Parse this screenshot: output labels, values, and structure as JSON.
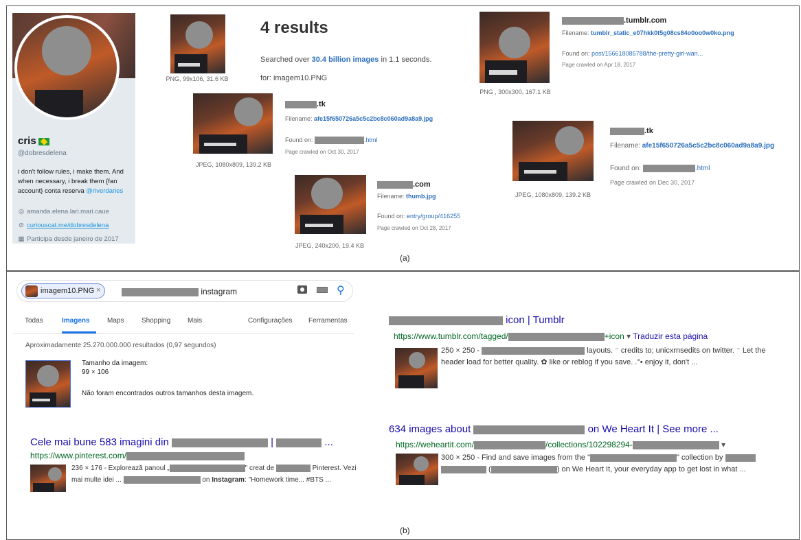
{
  "panel_a": {
    "caption": "(a)",
    "profile": {
      "name": "cris",
      "handle": "@dobresdelena",
      "bio": "i don't follow rules, i make them. And when necessary, i break them {fan account} conta reserva ",
      "bio_mention": "@riverdaries",
      "location": "amanda.elena.lari.mari.caue",
      "link": "curiouscat.me/dobresdelena",
      "joined": "Participa desde janeiro de 2017"
    },
    "query_image": {
      "meta": "PNG, 99x106, 31.6 KB"
    },
    "summary": {
      "results_title": "4 results",
      "searched_prefix": "Searched over ",
      "searched_count": "30.4 billion images",
      "searched_suffix": " in 1.1 seconds.",
      "for_label": "for: imagem10.PNG"
    },
    "matches": [
      {
        "host_suffix": ".tk",
        "filename_label": "Filename: ",
        "filename": "afe15f650726a5c5c2bc8c060ad9a8a9.jpg",
        "found_label": "Found on: ",
        "found_suffix": ".html",
        "crawled": "Page crawled on Oct 30, 2017",
        "meta": "JPEG, 1080x809, 139.2 KB"
      },
      {
        "host_suffix": ".com",
        "filename_label": "Filename: ",
        "filename": "thumb.jpg",
        "found_label": "Found on: ",
        "found_link": "entry/group/416255",
        "crawled": "Page crawled on Oct 28, 2017",
        "meta": "JPEG, 240x200, 19.4 KB"
      },
      {
        "host_suffix": ".tumblr.com",
        "filename_label": "Filename: ",
        "filename": "tumblr_static_e07hkk0t5g08cs84o0oo0w0ko.png",
        "found_label": "Found on: ",
        "found_link": "post/156618085788/the-pretty-girl-wan...",
        "crawled": "Page crawled on Apr 18, 2017",
        "meta": "PNG , 300x300, 167.1 KB"
      },
      {
        "host_suffix": ".tk",
        "filename_label": "Filename: ",
        "filename": "afe15f650726a5c5c2bc8c060ad9a8a9.jpg",
        "found_label": "Found on: ",
        "found_suffix": ".html",
        "crawled": "Page crawled on Dec 30, 2017",
        "meta": "JPEG, 1080x809, 139.2 KB"
      }
    ]
  },
  "panel_b": {
    "caption": "(b)",
    "search": {
      "chip_label": "imagem10.PNG",
      "chip_close": "×",
      "query_suffix": "instagram"
    },
    "tabs": [
      "Todas",
      "Imagens",
      "Maps",
      "Shopping",
      "Mais",
      "Configurações",
      "Ferramentas"
    ],
    "stats": "Aproximadamente 25.270.000.000 resultados (0,97 segundos)",
    "image_info": {
      "size_label": "Tamanho da imagem:",
      "size_value": "99 × 106",
      "no_other": "Não foram encontrados outros tamanhos desta imagem."
    },
    "results": [
      {
        "title_prefix": "Cele mai bune 583 imagini din ",
        "title_mid": " | ",
        "title_suffix": " ...",
        "url": "https://www.pinterest.com/",
        "snip1_a": "236 × 176 - Explorează panoul „",
        "snip1_b": "\" creat de ",
        "snip1_c": " Pinterest. Vezi",
        "snip2_a": "mai multe idei ... ",
        "snip2_b": " on ",
        "snip2_bold": "Instagram",
        "snip2_c": ": \"Homework time... #BTS ..."
      },
      {
        "title_suffix": " icon | Tumblr",
        "url_a": "https://www.tumblr.com/tagged/",
        "url_b": "+icon",
        "translate": "Traduzir esta página",
        "snip1_a": "250 × 250 - ",
        "snip1_b": " layouts. ⁻ credits to; unicxrnsedits on twitter. ⁻ Let the",
        "snip2": "header load for better quality. ✿ like or reblog if you save. .°• enjoy it, don't ..."
      },
      {
        "title_prefix": "634 images about ",
        "title_suffix": " on We Heart It | See more ...",
        "url_a": "https://weheartit.com/",
        "url_b": "/collections/102298294-",
        "snip1_a": "300 × 250 - Find and save images from the \"",
        "snip1_b": "\" collection by ",
        "snip2_a": " (",
        "snip2_b": ") on We Heart It, your everyday app to get lost in what ..."
      }
    ]
  }
}
